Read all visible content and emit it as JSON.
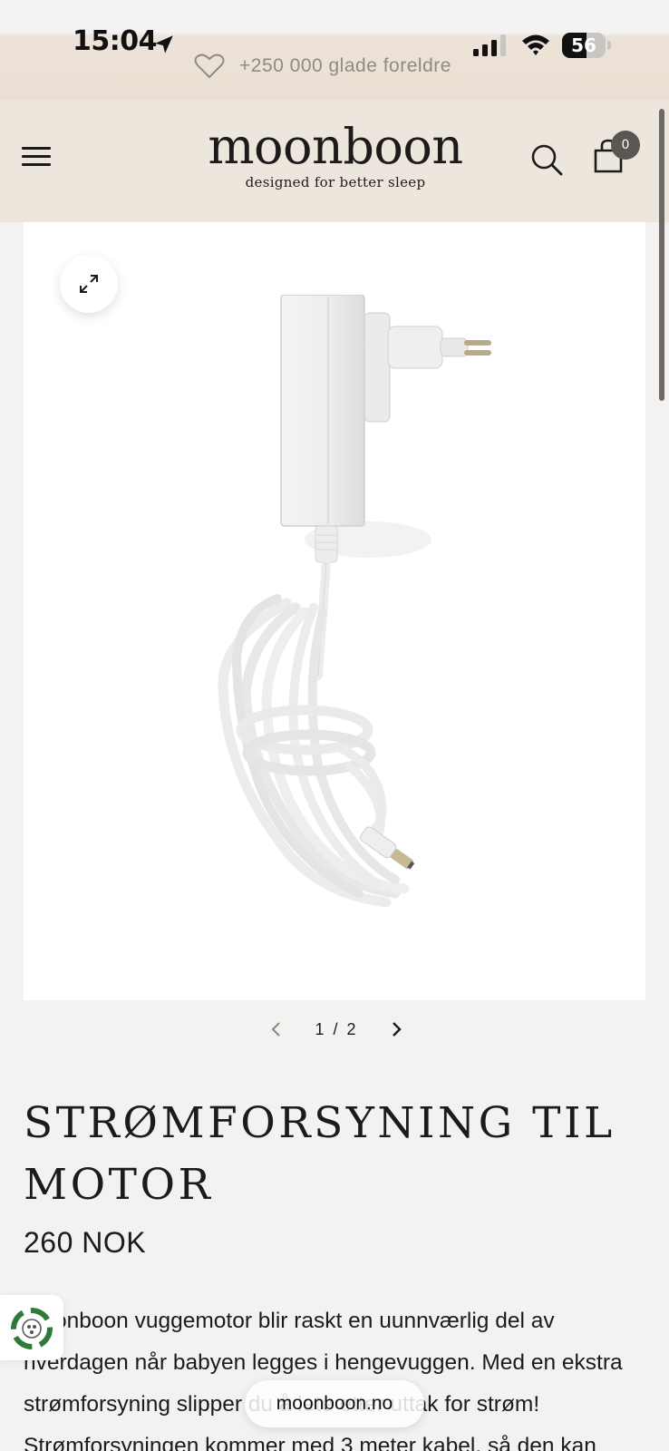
{
  "status_bar": {
    "time": "15:04",
    "battery_level": "56",
    "battery_fraction": 0.56
  },
  "announcement": {
    "text": "+250 000 glade foreldre",
    "icon": "heart-icon"
  },
  "header": {
    "logo": "moonboon",
    "tagline": "designed for better sleep",
    "cart_count": "0",
    "icons": [
      "menu-icon",
      "search-icon",
      "cart-icon"
    ]
  },
  "gallery": {
    "current": "1",
    "separator": "/",
    "total": "2",
    "expand_icon": "expand-icon"
  },
  "product": {
    "title": "STRØMFORSYNING TIL MOTOR",
    "price": "260 NOK",
    "description": "Moonboon vuggemotor blir raskt en uunnværlig del av hverdagen når babyen legges i hengevuggen. Med en ekstra strømforsyning slipper du å lete etter uttak for strøm! Strømforsyningen kommer med 3 meter kabel, så den kan"
  },
  "browser": {
    "url": "moonboon.no"
  },
  "colors": {
    "header_bg": "#ede6dd",
    "page_bg": "#f3f2f0",
    "text": "#1d1b1a",
    "badge": "#5b5651"
  }
}
